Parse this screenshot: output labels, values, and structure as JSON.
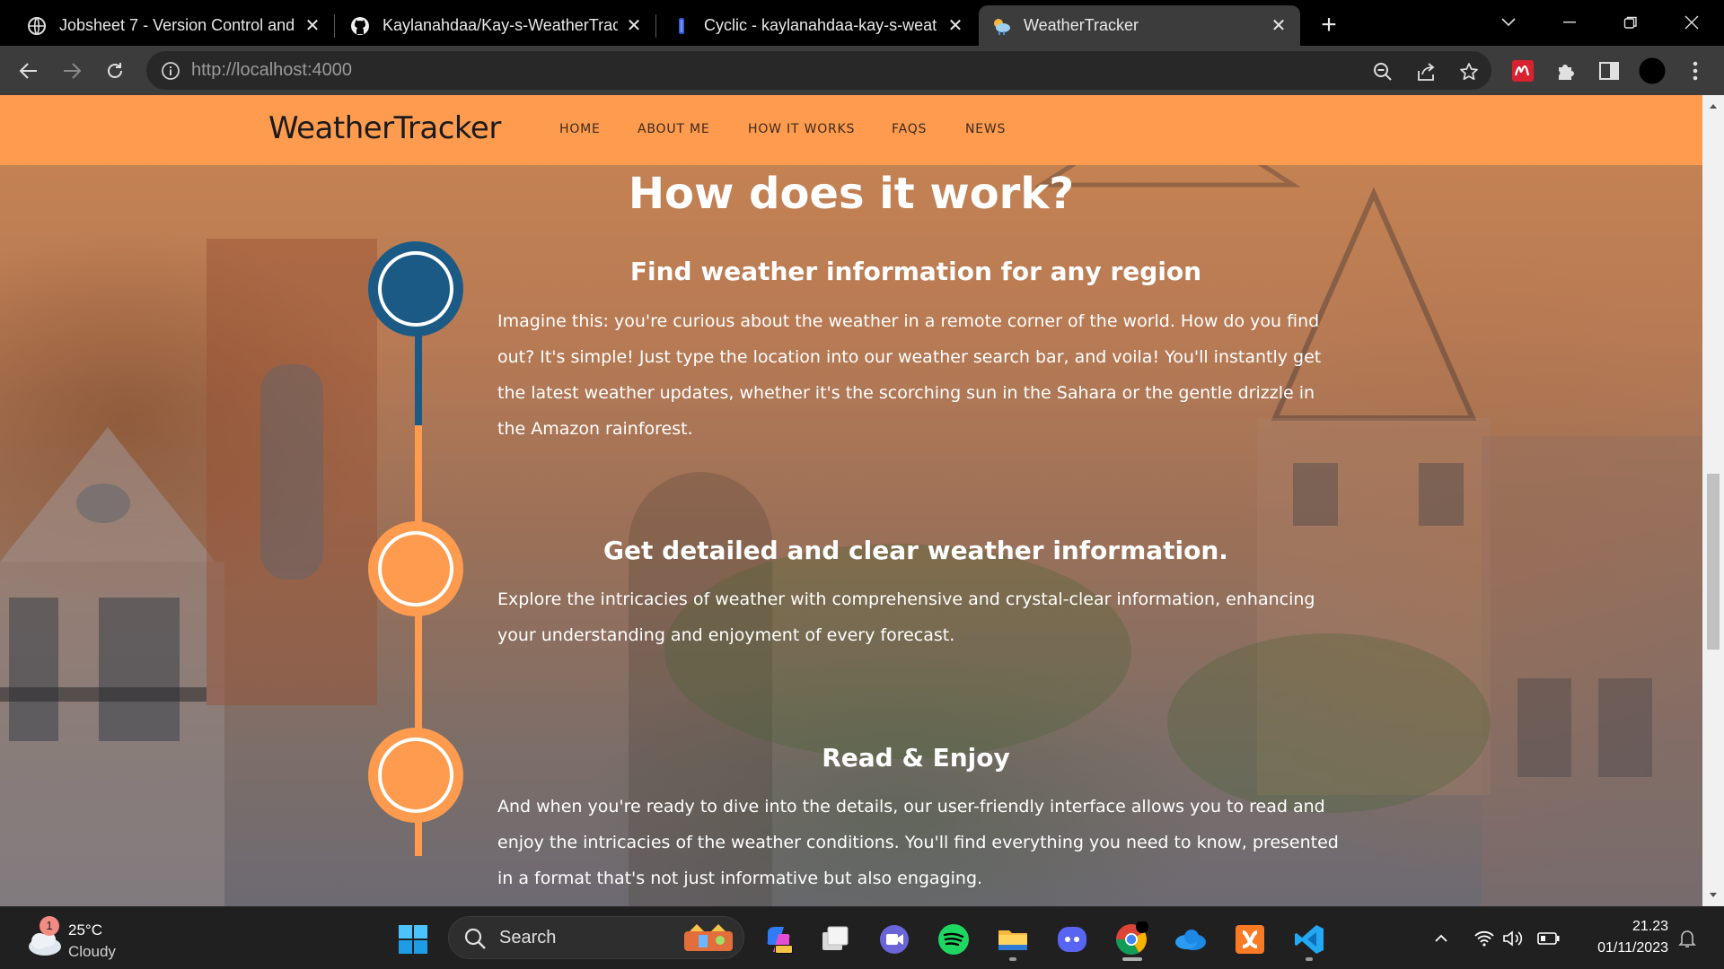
{
  "browser": {
    "tabs": [
      {
        "title": "Jobsheet 7 - Version Control and",
        "icon": "globe-icon",
        "active": false
      },
      {
        "title": "Kaylanahdaa/Kay-s-WeatherTrac",
        "icon": "github-icon",
        "active": false
      },
      {
        "title": "Cyclic - kaylanahdaa-kay-s-weat",
        "icon": "cyclic-icon",
        "active": false
      },
      {
        "title": "WeatherTracker",
        "icon": "weather-icon",
        "active": true
      }
    ],
    "close_glyph": "✕",
    "new_tab_glyph": "+",
    "url_host": "http://localhost",
    "url_port": ":4000"
  },
  "site": {
    "brand": "WeatherTracker",
    "nav": [
      "HOME",
      "ABOUT ME",
      "HOW IT WORKS",
      "FAQS",
      "NEWS"
    ],
    "section_title": "How does it work?",
    "steps": [
      {
        "title": "Find weather information for any region",
        "body": "Imagine this: you're curious about the weather in a remote corner of the world. How do you find out? It's simple! Just type the location into our weather search bar, and voila! You'll instantly get the latest weather updates, whether it's the scorching sun in the Sahara or the gentle drizzle in the Amazon rainforest.",
        "color": "#1b5a84"
      },
      {
        "title": "Get detailed and clear weather information.",
        "body": "Explore the intricacies of weather with comprehensive and crystal-clear information, enhancing your understanding and enjoyment of every forecast.",
        "color": "#ff9b4f"
      },
      {
        "title": "Read & Enjoy",
        "body": "And when you're ready to dive into the details, our user-friendly interface allows you to read and enjoy the intricacies of the weather conditions. You'll find everything you need to know, presented in a format that's not just informative but also engaging.",
        "color": "#ff9b4f"
      }
    ],
    "colors": {
      "header": "#ff9b4f",
      "accent_blue": "#1b5a84",
      "accent_orange": "#ff9b4f"
    }
  },
  "taskbar": {
    "weather": {
      "temp": "25°C",
      "condition": "Cloudy",
      "badge": "1"
    },
    "search_label": "Search",
    "clock_time": "21.23",
    "clock_date": "01/11/2023"
  }
}
